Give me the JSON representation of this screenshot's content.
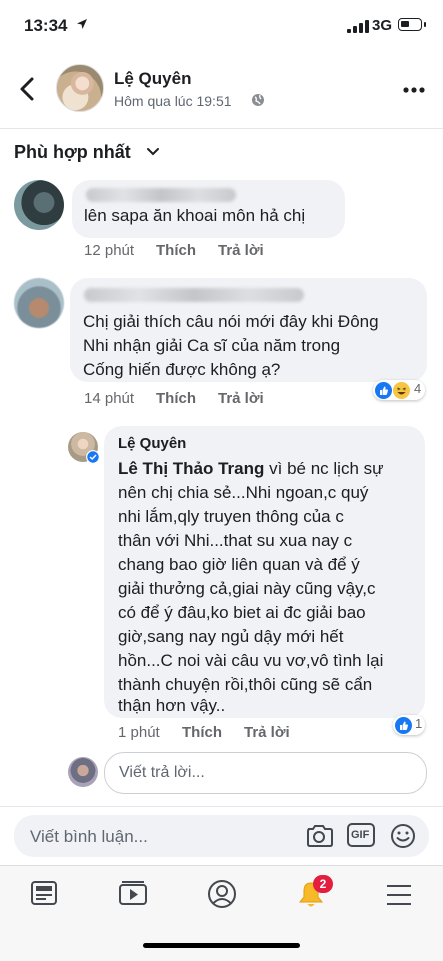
{
  "status_bar": {
    "time": "13:34",
    "network": "3G"
  },
  "post_header": {
    "name": "Lệ Quyên",
    "time": "Hôm qua lúc 19:51"
  },
  "sort": {
    "label": "Phù hợp nhất"
  },
  "comments": [
    {
      "text": "lên sapa ăn khoai môn hả chị",
      "time": "12 phút",
      "like_label": "Thích",
      "reply_label": "Trả lời"
    },
    {
      "lines": [
        "Chị giải thích câu nói mới đây khi Đông",
        "Nhi nhận giải Ca sĩ của năm trong",
        "Cống hiến được không ạ?"
      ],
      "time": "14 phút",
      "like_label": "Thích",
      "reply_label": "Trả lời",
      "reaction_count": "4"
    }
  ],
  "reply": {
    "author": "Lệ Quyên",
    "tag": "Lê Thị Thảo Trang",
    "first_line_rest": " vì bé nc lịch sự",
    "lines": [
      "nên chị chia sẻ...Nhi ngoan,c quý",
      "nhi lắm,qly truyen thông của c",
      "thân với Nhi...that su xua nay c",
      "chang bao giờ liên quan và để ý",
      "giải thưởng cả,giai này cũng vậy,c",
      "có để ý đâu,ko biet ai đc giải bao",
      "giờ,sang nay ngủ dậy mới hết",
      "hồn...C noi vài câu vu vơ,vô tình lại",
      "thành chuyện rồi,thôi cũng sẽ cẩn",
      "thận hơn vậy.."
    ],
    "time": "1 phút",
    "like_label": "Thích",
    "reply_label": "Trả lời",
    "reaction_count": "1"
  },
  "reply_input": {
    "placeholder": "Viết trả lời..."
  },
  "compose": {
    "placeholder": "Viết bình luận...",
    "gif_label": "GIF"
  },
  "tabbar": {
    "notification_badge": "2"
  },
  "colors": {
    "accent": "#1877f2",
    "badge": "#e41e3f",
    "bubble": "#f0f2f5"
  }
}
